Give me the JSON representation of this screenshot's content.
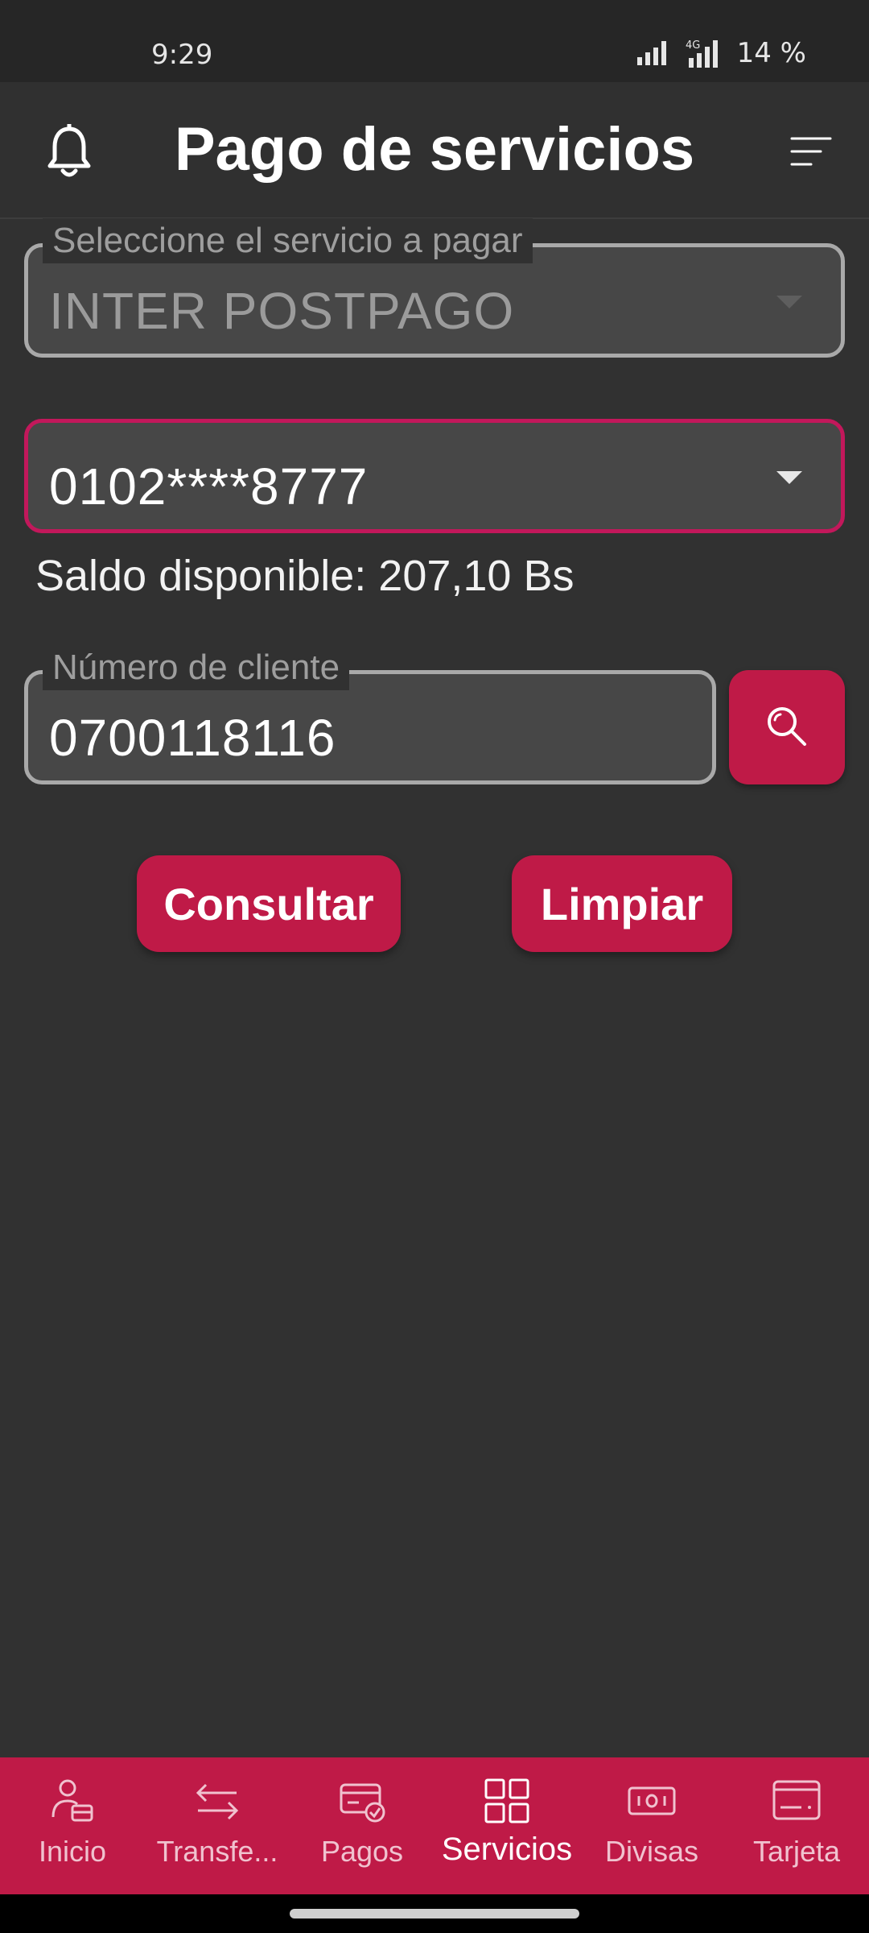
{
  "status_bar": {
    "time": "9:29",
    "network": "4G",
    "battery": "14 %"
  },
  "header": {
    "title": "Pago de servicios",
    "left_icon": "bell-icon",
    "right_icon": "menu-icon"
  },
  "form": {
    "service": {
      "label": "Seleccione el servicio a pagar",
      "value": "INTER POSTPAGO"
    },
    "account": {
      "value": "0102****8777"
    },
    "balance": "Saldo disponible: 207,10 Bs",
    "client_number": {
      "label": "Número de cliente",
      "value": "0700118116"
    }
  },
  "actions": {
    "consult_label": "Consultar",
    "clear_label": "Limpiar"
  },
  "bottom_nav": {
    "items": [
      {
        "label": "Inicio",
        "icon": "home-user-icon"
      },
      {
        "label": "Transfe...",
        "icon": "transfer-arrows-icon"
      },
      {
        "label": "Pagos",
        "icon": "card-check-icon"
      },
      {
        "label": "Servicios",
        "icon": "grid-icon",
        "active": true
      },
      {
        "label": "Divisas",
        "icon": "banknote-icon"
      },
      {
        "label": "Tarjeta",
        "icon": "card-icon"
      }
    ]
  },
  "colors": {
    "accent": "#bf1a47",
    "background": "#313131",
    "field_bg": "#474747"
  }
}
